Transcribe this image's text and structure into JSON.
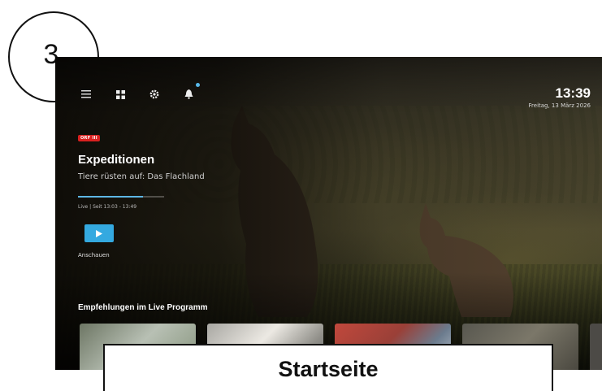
{
  "step": {
    "number": "3"
  },
  "caption": {
    "text": "Startseite"
  },
  "header": {
    "time": "13:39",
    "date": "Freitag, 13 März 2026",
    "nav_icons": [
      "menu-icon",
      "grid-icon",
      "gear-icon",
      "bell-icon"
    ],
    "notification_dot_color": "#58b9ea"
  },
  "program": {
    "channel_logo": "ORF III",
    "title": "Expeditionen",
    "subtitle": "Tiere rüsten auf: Das Flachland",
    "live_info": "Live  |  Seit 13:03 - 13:49",
    "progress_percent": 75,
    "watch_label": "Anschauen",
    "accent_color": "#34a9e0"
  },
  "recommendations": {
    "heading": "Empfehlungen im Live Programm",
    "tile_count": 4
  }
}
